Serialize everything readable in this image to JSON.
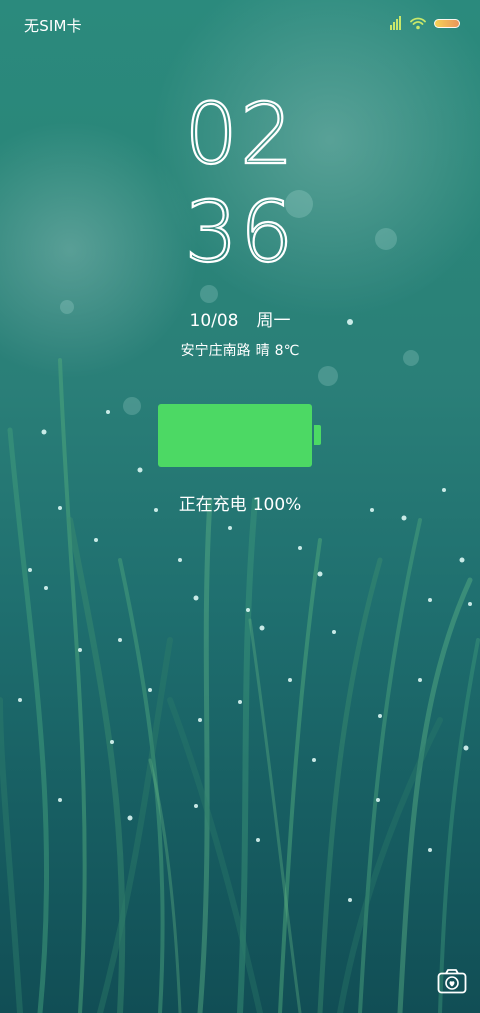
{
  "status_bar": {
    "carrier": "无SIM卡",
    "icons": [
      "signal-bars-icon",
      "wifi-icon",
      "battery-icon"
    ],
    "signal_level": 4,
    "battery_color": "#f0b55a"
  },
  "clock": {
    "hours": "02",
    "minutes": "36"
  },
  "date": {
    "date": "10/08",
    "weekday": "周一"
  },
  "weather": {
    "location": "安宁庄南路",
    "condition": "晴",
    "temperature": "8℃"
  },
  "charging": {
    "label": "正在充电",
    "percent": "100%",
    "level": 1.0,
    "color": "#4cd964"
  },
  "shortcuts": {
    "camera_icon": "camera-icon"
  }
}
